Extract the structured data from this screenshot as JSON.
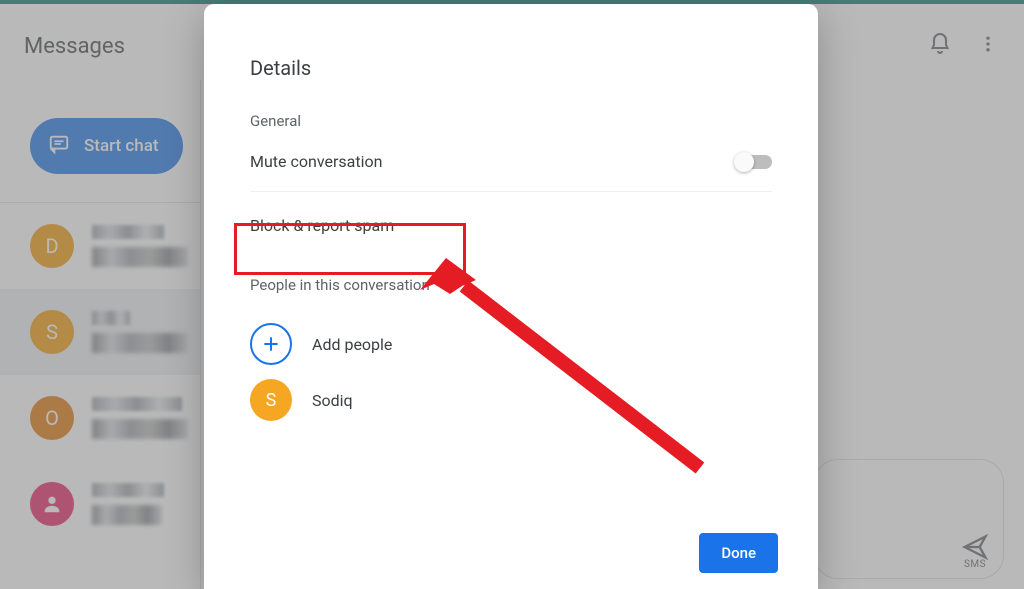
{
  "app": {
    "title": "Messages"
  },
  "actions": {
    "start_chat": "Start chat"
  },
  "sidebar": {
    "items": [
      {
        "initial": "D",
        "color": "#f29900"
      },
      {
        "initial": "S",
        "color": "#f29900"
      },
      {
        "initial": "O",
        "color": "#e37400"
      },
      {
        "initial": "",
        "color": "#e91e63",
        "icon": "person"
      }
    ]
  },
  "compose": {
    "sms_label": "SMS"
  },
  "modal": {
    "title": "Details",
    "section_general": "General",
    "mute_label": "Mute conversation",
    "mute_on": false,
    "block_label": "Block & report spam",
    "section_people": "People in this conversation",
    "add_people_label": "Add people",
    "people": [
      {
        "name": "Sodiq",
        "initial": "S",
        "color": "#f5a623"
      }
    ],
    "done_label": "Done"
  },
  "annotation": {
    "color": "#e51c23",
    "target": "block-report-spam"
  }
}
